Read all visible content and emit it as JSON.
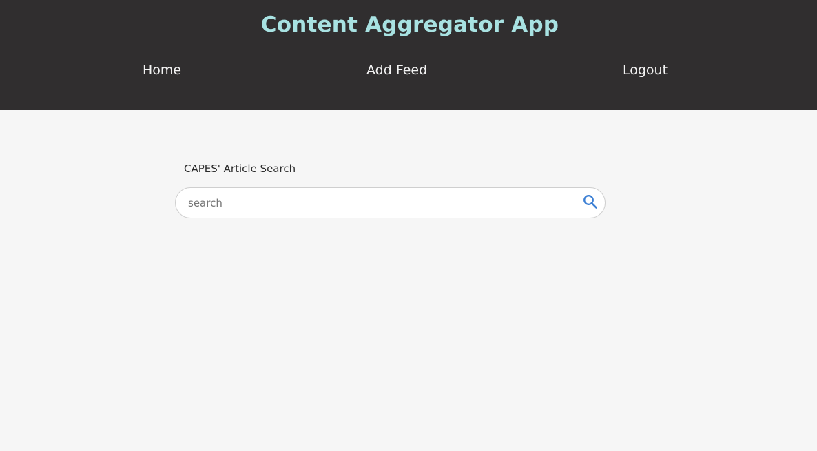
{
  "header": {
    "title": "Content Aggregator App",
    "title_color": "#a8e2e2",
    "background": "#302e2f"
  },
  "nav": {
    "home": "Home",
    "add_feed": "Add Feed",
    "logout": "Logout"
  },
  "search": {
    "label": "CAPES' Article Search",
    "placeholder": "search",
    "value": "",
    "icon": "search-icon",
    "icon_color": "#3b7fd4"
  }
}
